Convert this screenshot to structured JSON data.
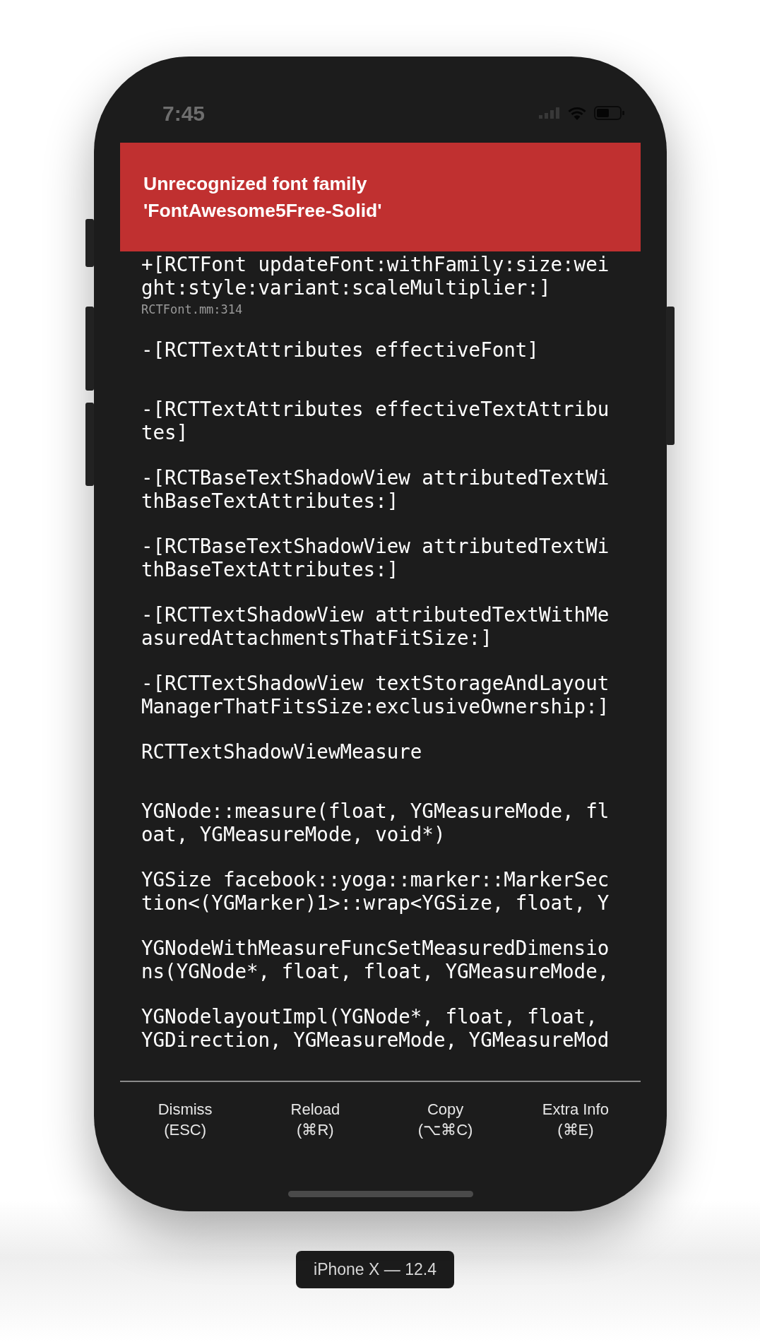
{
  "status_bar": {
    "time": "7:45"
  },
  "error": {
    "title": "Unrecognized font family 'FontAwesome5Free-Solid'"
  },
  "stack": [
    {
      "method": "+[RCTFont updateFont:withFamily:size:weight:style:variant:scaleMultiplier:]",
      "file": "RCTFont.mm:314"
    },
    {
      "method": "-[RCTTextAttributes effectiveFont]"
    },
    {
      "method": "-[RCTTextAttributes effectiveTextAttributes]"
    },
    {
      "method": "-[RCTBaseTextShadowView attributedTextWithBaseTextAttributes:]"
    },
    {
      "method": "-[RCTBaseTextShadowView attributedTextWithBaseTextAttributes:]"
    },
    {
      "method": "-[RCTTextShadowView attributedTextWithMeasuredAttachmentsThatFitSize:]"
    },
    {
      "method": "-[RCTTextShadowView textStorageAndLayoutManagerThatFitsSize:exclusiveOwnership:]"
    },
    {
      "method": "RCTTextShadowViewMeasure"
    },
    {
      "method": "YGNode::measure(float, YGMeasureMode, float, YGMeasureMode, void*)"
    },
    {
      "method": "YGSize facebook::yoga::marker::MarkerSection<(YGMarker)1>::wrap<YGSize, float, Y"
    },
    {
      "method": "YGNodeWithMeasureFuncSetMeasuredDimensions(YGNode*, float, float, YGMeasureMode,"
    },
    {
      "method": "YGNodelayoutImpl(YGNode*, float, float, YGDirection, YGMeasureMode, YGMeasureMod"
    }
  ],
  "buttons": [
    {
      "label": "Dismiss",
      "shortcut": "(ESC)"
    },
    {
      "label": "Reload",
      "shortcut": "(⌘R)"
    },
    {
      "label": "Copy",
      "shortcut": "(⌥⌘C)"
    },
    {
      "label": "Extra Info",
      "shortcut": "(⌘E)"
    }
  ],
  "device_label": "iPhone X — 12.4"
}
